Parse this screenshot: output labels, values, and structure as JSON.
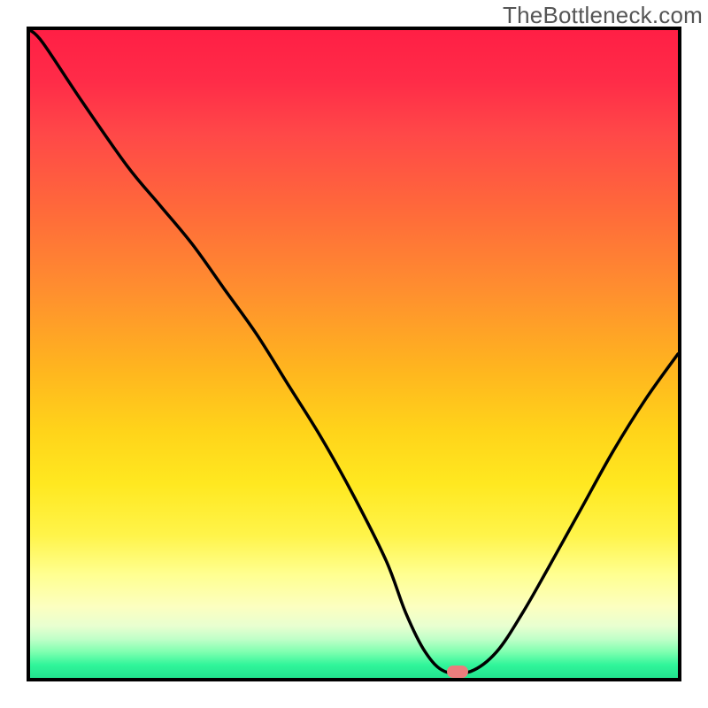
{
  "watermark": "TheBottleneck.com",
  "chart_data": {
    "type": "line",
    "title": "",
    "xlabel": "",
    "ylabel": "",
    "xlim": [
      0,
      1
    ],
    "ylim": [
      0,
      1
    ],
    "x": [
      0.0,
      0.02,
      0.08,
      0.15,
      0.2,
      0.25,
      0.3,
      0.35,
      0.4,
      0.45,
      0.5,
      0.55,
      0.58,
      0.61,
      0.64,
      0.68,
      0.72,
      0.76,
      0.8,
      0.85,
      0.9,
      0.95,
      1.0
    ],
    "values": [
      1.0,
      0.98,
      0.89,
      0.79,
      0.73,
      0.67,
      0.6,
      0.53,
      0.45,
      0.37,
      0.28,
      0.18,
      0.1,
      0.04,
      0.01,
      0.01,
      0.04,
      0.1,
      0.17,
      0.26,
      0.35,
      0.43,
      0.5
    ],
    "marker": {
      "x": 0.66,
      "y": 0.01
    },
    "background": {
      "type": "vertical-gradient",
      "stops": [
        {
          "pos": 0.0,
          "color": "#ff1f45"
        },
        {
          "pos": 0.5,
          "color": "#ffcc1f"
        },
        {
          "pos": 0.82,
          "color": "#ffff90"
        },
        {
          "pos": 1.0,
          "color": "#22e38e"
        }
      ]
    }
  }
}
